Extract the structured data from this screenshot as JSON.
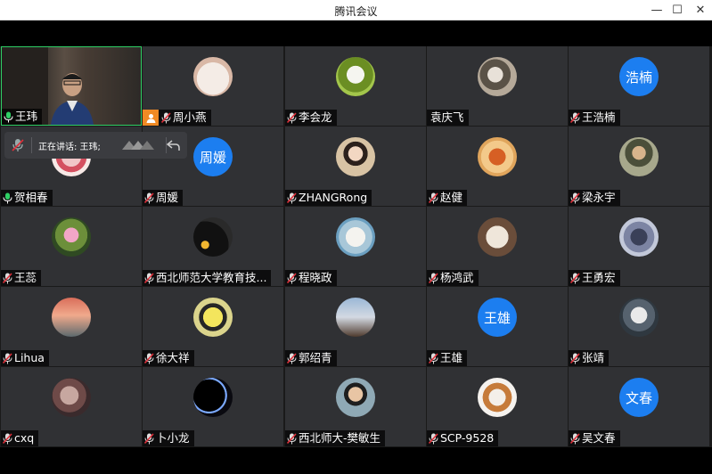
{
  "window": {
    "title": "腾讯会议",
    "minimize_glyph": "—",
    "maximize_glyph": "☐",
    "close_glyph": "✕"
  },
  "speaking_indicator": {
    "label": "正在讲话: 王玮;"
  },
  "participants": [
    {
      "name": "王玮",
      "mic": "on",
      "avatar": "video"
    },
    {
      "name": "周小燕",
      "mic": "muted",
      "host": true,
      "avatar": "family-cartoon"
    },
    {
      "name": "李会龙",
      "mic": "muted",
      "avatar": "panda"
    },
    {
      "name": "袁庆飞",
      "mic": "none",
      "avatar": "blossom"
    },
    {
      "name": "王浩楠",
      "mic": "muted",
      "avatar": "text",
      "avatar_text": "浩楠"
    },
    {
      "name": "贺相春",
      "mic": "on",
      "avatar": "flowers"
    },
    {
      "name": "周媛",
      "mic": "muted",
      "avatar": "text",
      "avatar_text": "周媛"
    },
    {
      "name": "ZHANGRong",
      "mic": "muted",
      "avatar": "woman"
    },
    {
      "name": "赵健",
      "mic": "muted",
      "avatar": "chess-piece"
    },
    {
      "name": "梁永宇",
      "mic": "muted",
      "avatar": "man-outdoor"
    },
    {
      "name": "王蕊",
      "mic": "muted",
      "avatar": "lotus"
    },
    {
      "name": "西北师范大学教育技...",
      "mic": "muted",
      "avatar": "dark-city"
    },
    {
      "name": "程晓政",
      "mic": "muted",
      "avatar": "cat"
    },
    {
      "name": "杨鸿武",
      "mic": "muted",
      "avatar": "cartoon-animal"
    },
    {
      "name": "王勇宏",
      "mic": "muted",
      "avatar": "tower"
    },
    {
      "name": "Lihua",
      "mic": "muted",
      "avatar": "sunset"
    },
    {
      "name": "徐大祥",
      "mic": "muted",
      "avatar": "yellow-girl"
    },
    {
      "name": "郭绍青",
      "mic": "muted",
      "avatar": "mountain-man"
    },
    {
      "name": "王雄",
      "mic": "muted",
      "avatar": "text",
      "avatar_text": "王雄"
    },
    {
      "name": "张靖",
      "mic": "muted",
      "avatar": "astronaut"
    },
    {
      "name": "cxq",
      "mic": "muted",
      "avatar": "horse"
    },
    {
      "name": "卜小龙",
      "mic": "muted",
      "avatar": "eclipse"
    },
    {
      "name": "西北师大-樊敏生",
      "mic": "muted",
      "avatar": "glasses-man"
    },
    {
      "name": "SCP-9528",
      "mic": "muted",
      "avatar": "shiba"
    },
    {
      "name": "吴文春",
      "mic": "muted",
      "avatar": "text",
      "avatar_text": "文春"
    }
  ],
  "colors": {
    "tile_bg": "#303134",
    "active_border": "#2fcf65",
    "mic_on": "#2fcf65",
    "mic_muted": "#e0303a",
    "text_avatar": "#1c7ef0",
    "host_badge": "#f08a24"
  }
}
